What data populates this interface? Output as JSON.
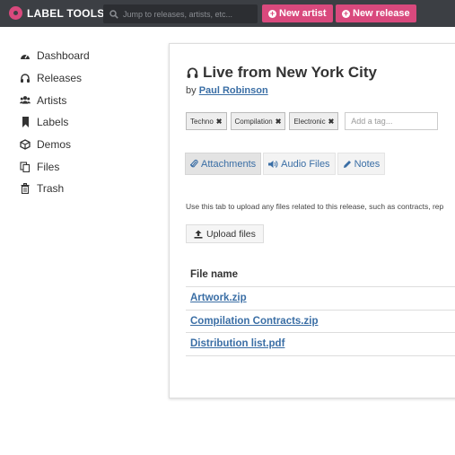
{
  "app": {
    "logo_text": "LABEL TOOLS",
    "accent_color": "#d9497d",
    "topbar_color": "#3c3f44"
  },
  "search": {
    "placeholder": "Jump to releases, artists, etc..."
  },
  "header_buttons": {
    "new_artist": "New artist",
    "new_release": "New release"
  },
  "sidebar": {
    "items": [
      {
        "label": "Dashboard",
        "icon": "dashboard-icon"
      },
      {
        "label": "Releases",
        "icon": "headphones-icon"
      },
      {
        "label": "Artists",
        "icon": "users-icon"
      },
      {
        "label": "Labels",
        "icon": "bookmark-icon"
      },
      {
        "label": "Demos",
        "icon": "cube-icon"
      },
      {
        "label": "Files",
        "icon": "files-icon"
      },
      {
        "label": "Trash",
        "icon": "trash-icon"
      }
    ]
  },
  "release": {
    "title": "Live from New York City",
    "by_prefix": "by",
    "artist": "Paul Robinson",
    "tags": [
      "Techno",
      "Compilation",
      "Electronic"
    ],
    "tag_placeholder": "Add a tag..."
  },
  "tabs": [
    {
      "label": "Attachments",
      "icon": "paperclip-icon",
      "active": true
    },
    {
      "label": "Audio Files",
      "icon": "volume-icon",
      "active": false
    },
    {
      "label": "Notes",
      "icon": "pencil-icon",
      "active": false
    }
  ],
  "attachments": {
    "description": "Use this tab to upload any files related to this release, such as contracts, rep",
    "upload_label": "Upload files",
    "column_header": "File name",
    "files": [
      "Artwork.zip",
      "Compilation Contracts.zip",
      "Distribution list.pdf"
    ]
  }
}
